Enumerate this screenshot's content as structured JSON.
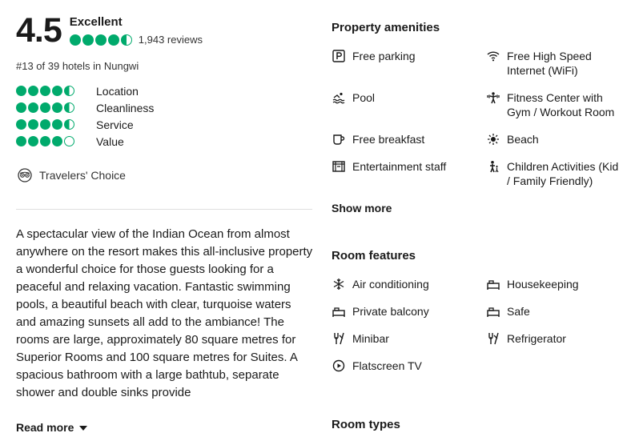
{
  "rating": {
    "score": "4.5",
    "label": "Excellent",
    "bubbles": 4.5,
    "reviews": "1,943 reviews",
    "rank": "#13 of 39 hotels in Nungwi"
  },
  "subratings": [
    {
      "label": "Location",
      "bubbles": 4.5
    },
    {
      "label": "Cleanliness",
      "bubbles": 4.5
    },
    {
      "label": "Service",
      "bubbles": 4.5
    },
    {
      "label": "Value",
      "bubbles": 4
    }
  ],
  "travelers_choice": "Travelers' Choice",
  "description": "A spectacular view of the Indian Ocean from almost anywhere on the resort makes this all-inclusive property a wonderful choice for those guests looking for a peaceful and relaxing vacation. Fantastic swimming pools, a beautiful beach with clear, turquoise waters and amazing sunsets all add to the ambiance! The rooms are large, approximately 80 square metres for Superior Rooms and 100 square metres for Suites. A spacious bathroom with a large bathtub, separate shower and double sinks provide",
  "read_more": "Read more",
  "property_amenities": {
    "title": "Property amenities",
    "items": [
      {
        "label": "Free parking",
        "icon": "parking-icon"
      },
      {
        "label": "Free High Speed Internet (WiFi)",
        "icon": "wifi-icon"
      },
      {
        "label": "Pool",
        "icon": "pool-icon"
      },
      {
        "label": "Fitness Center with Gym / Workout Room",
        "icon": "fitness-icon"
      },
      {
        "label": "Free breakfast",
        "icon": "breakfast-icon"
      },
      {
        "label": "Beach",
        "icon": "beach-icon"
      },
      {
        "label": "Entertainment staff",
        "icon": "entertainment-icon"
      },
      {
        "label": "Children Activities (Kid / Family Friendly)",
        "icon": "children-icon"
      }
    ],
    "show_more": "Show more"
  },
  "room_features": {
    "title": "Room features",
    "items": [
      {
        "label": "Air conditioning",
        "icon": "snowflake-icon"
      },
      {
        "label": "Housekeeping",
        "icon": "housekeeping-icon"
      },
      {
        "label": "Private balcony",
        "icon": "balcony-icon"
      },
      {
        "label": "Safe",
        "icon": "safe-icon"
      },
      {
        "label": "Minibar",
        "icon": "minibar-icon"
      },
      {
        "label": "Refrigerator",
        "icon": "refrigerator-icon"
      },
      {
        "label": "Flatscreen TV",
        "icon": "tv-icon"
      }
    ]
  },
  "room_types": {
    "title": "Room types"
  },
  "colors": {
    "bubble": "#00aa6c",
    "text": "#1a1a1a"
  }
}
